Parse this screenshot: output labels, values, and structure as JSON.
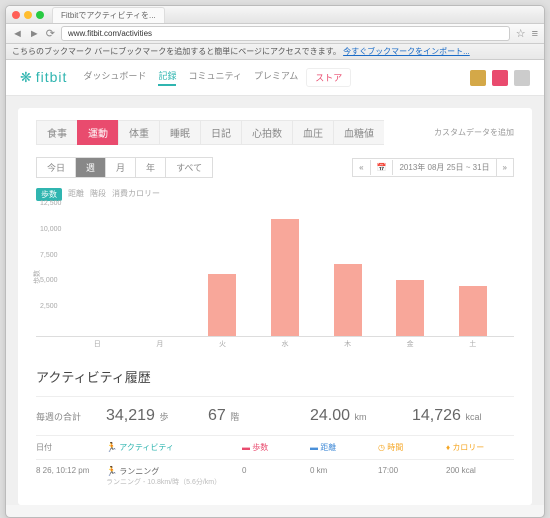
{
  "browser": {
    "tab_title": "Fitbitでアクティビティを...",
    "url": "www.fitbit.com/activities",
    "bookmark_msg": "こちらのブックマーク バーにブックマークを追加すると簡単にページにアクセスできます。",
    "bookmark_link": "今すぐブックマークをインポート..."
  },
  "header": {
    "logo": "fitbit",
    "nav": [
      "ダッシュボード",
      "記録",
      "コミュニティ",
      "プレミアム"
    ],
    "active": "記録",
    "store": "ストア"
  },
  "categories": {
    "items": [
      "食事",
      "運動",
      "体重",
      "睡眠",
      "日記",
      "心拍数",
      "血圧",
      "血糖値"
    ],
    "active": "運動",
    "custom": "カスタムデータを追加"
  },
  "period": {
    "items": [
      "今日",
      "週",
      "月",
      "年",
      "すべて"
    ],
    "active": "週",
    "date_label": "2013年 08月 25日 ~ 31日"
  },
  "chart_tabs": {
    "items": [
      "歩数",
      "距離",
      "階段",
      "消費カロリー"
    ],
    "active": "歩数"
  },
  "chart_data": {
    "type": "bar",
    "categories": [
      "日",
      "月",
      "火",
      "水",
      "木",
      "金",
      "土"
    ],
    "values": [
      0,
      0,
      6000,
      11300,
      7000,
      5400,
      4800
    ],
    "ylabel": "歩数",
    "yticks": [
      2500,
      5000,
      7500,
      10000,
      12500
    ],
    "ylim": [
      0,
      12500
    ]
  },
  "history": {
    "title": "アクティビティ履歴",
    "totals_label": "毎週の合計",
    "totals": [
      {
        "value": "34,219",
        "unit": "歩"
      },
      {
        "value": "67",
        "unit": "階"
      },
      {
        "value": "24.00",
        "unit": "km"
      },
      {
        "value": "14,726",
        "unit": "kcal"
      }
    ],
    "headers": {
      "date": "日付",
      "activity": "アクティビティ",
      "steps": "歩数",
      "dist": "距離",
      "time": "時間",
      "cal": "カロリー"
    },
    "rows": [
      {
        "date": "8 26, 10:12 pm",
        "activity": "ランニング",
        "sub": "ランニング - 10.8km/時（5.6分/km）",
        "steps": "0",
        "dist": "0 km",
        "time": "17:00",
        "cal": "200 kcal"
      }
    ]
  }
}
